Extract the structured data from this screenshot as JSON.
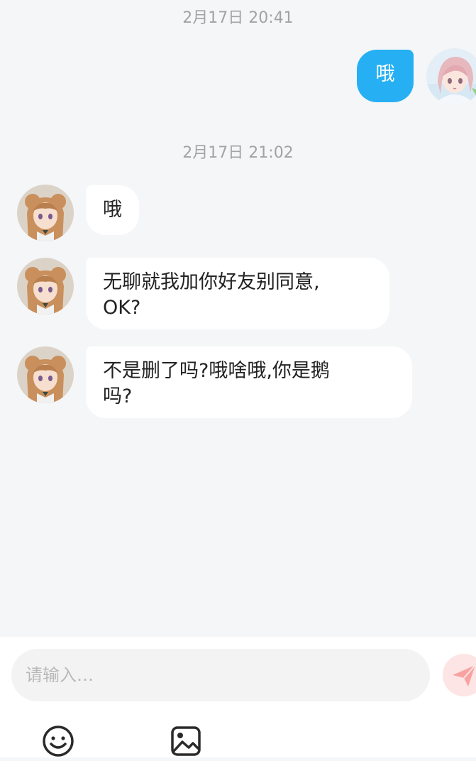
{
  "messages": [
    {
      "type": "timestamp",
      "text": "2月17日 20:41"
    },
    {
      "type": "message",
      "side": "right",
      "text": "哦"
    },
    {
      "type": "timestamp",
      "text": "2月17日 21:02"
    },
    {
      "type": "message",
      "side": "left",
      "text": "哦"
    },
    {
      "type": "message",
      "side": "left",
      "lines": [
        "无聊就我加你好友别同意,",
        "OK?"
      ]
    },
    {
      "type": "message",
      "side": "left",
      "lines": [
        "不是删了吗?哦啥哦,你是鹅",
        "吗?"
      ]
    }
  ],
  "composer": {
    "placeholder": "请输入…",
    "send_icon": "send-icon",
    "tools": [
      {
        "icon": "emoji-icon"
      },
      {
        "icon": "image-icon"
      }
    ]
  },
  "colors": {
    "background": "#f5f6f8",
    "self_bubble": "#26b0f3",
    "other_bubble": "#ffffff",
    "timestamp": "#a3a3a3",
    "send_button": "#fde5e5",
    "send_icon": "#f9a2a2"
  }
}
